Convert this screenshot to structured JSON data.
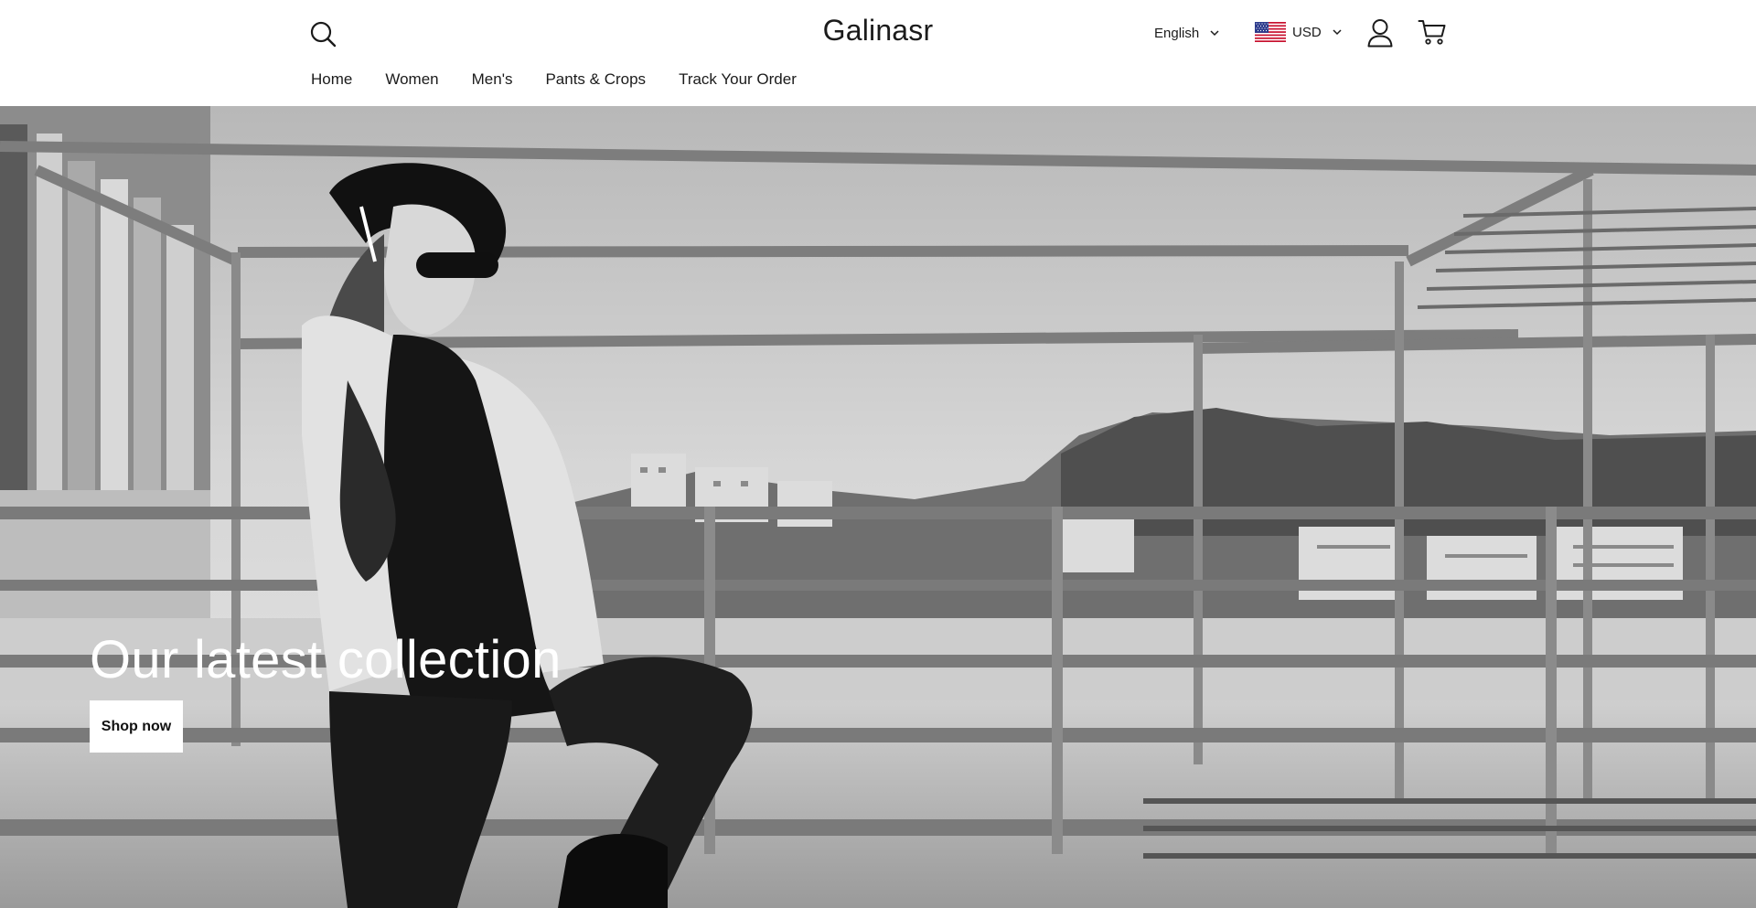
{
  "brand": {
    "name": "Galinasr"
  },
  "header": {
    "search_icon": "search-icon",
    "language": {
      "selected": "English",
      "icon": "chevron-down-icon"
    },
    "currency": {
      "selected": "USD",
      "flag_icon": "us-flag-icon",
      "icon": "chevron-down-icon"
    },
    "account_icon": "user-icon",
    "cart_icon": "cart-icon"
  },
  "nav": {
    "items": [
      {
        "label": "Home"
      },
      {
        "label": "Women"
      },
      {
        "label": "Men's"
      },
      {
        "label": "Pants & Crops"
      },
      {
        "label": "Track Your Order"
      }
    ]
  },
  "hero": {
    "heading": "Our latest collection",
    "button_label": "Shop now",
    "image": "black-and-white-rooftop-fashion-photo"
  }
}
